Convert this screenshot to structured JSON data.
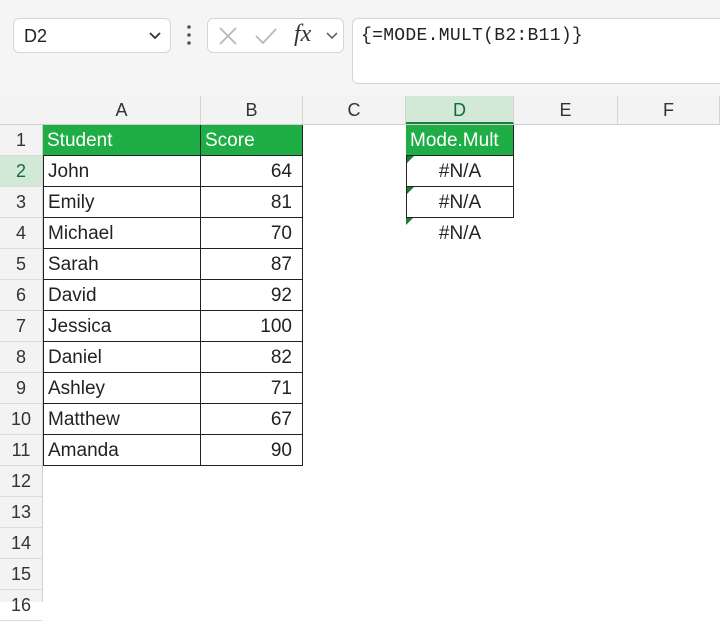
{
  "name_box": {
    "value": "D2"
  },
  "formula_bar": {
    "fx_label": "fx",
    "formula": "{=MODE.MULT(B2:B11)}"
  },
  "columns": [
    "A",
    "B",
    "C",
    "D",
    "E",
    "F"
  ],
  "rows": [
    "1",
    "2",
    "3",
    "4",
    "5",
    "6",
    "7",
    "8",
    "9",
    "10",
    "11",
    "12",
    "13",
    "14",
    "15",
    "16"
  ],
  "table": {
    "headers": {
      "student": "Student",
      "score": "Score"
    },
    "data": [
      {
        "student": "John",
        "score": "64"
      },
      {
        "student": "Emily",
        "score": "81"
      },
      {
        "student": "Michael",
        "score": "70"
      },
      {
        "student": "Sarah",
        "score": "87"
      },
      {
        "student": "David",
        "score": "92"
      },
      {
        "student": "Jessica",
        "score": "100"
      },
      {
        "student": "Daniel",
        "score": "82"
      },
      {
        "student": "Ashley",
        "score": "71"
      },
      {
        "student": "Matthew",
        "score": "67"
      },
      {
        "student": "Amanda",
        "score": "90"
      }
    ]
  },
  "mode_column": {
    "header": "Mode.Mult",
    "values": [
      "#N/A",
      "#N/A",
      "#N/A"
    ]
  },
  "colors": {
    "header_green": "#1fae46",
    "selection_green": "#d3e9d8",
    "error_triangle": "#1e7a3a"
  }
}
